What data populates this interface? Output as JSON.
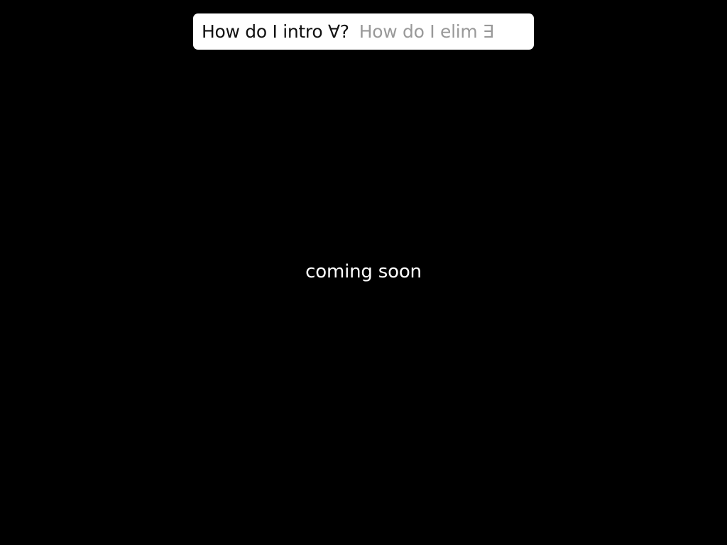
{
  "prompt_bar": {
    "question": "How do I intro ∀?",
    "suggestion": "How do I elim ∃"
  },
  "main": {
    "status_message": "coming soon"
  },
  "colors": {
    "background": "#000000",
    "bar_background": "#ffffff",
    "question_text": "#111111",
    "suggestion_text": "#999999",
    "message_text": "#ffffff"
  }
}
